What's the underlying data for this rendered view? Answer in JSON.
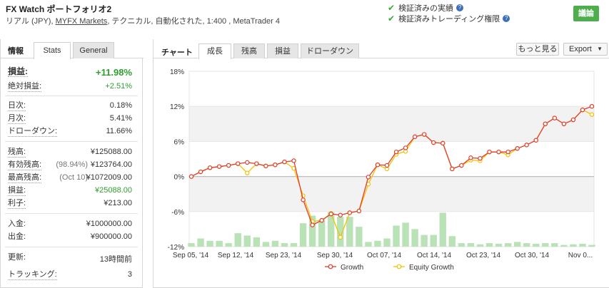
{
  "header": {
    "title": "FX Watch ポートフォリオ2",
    "sub_type": "リアル (JPY),",
    "sub_broker": "MYFX Markets",
    "sub_rest": ", テクニカル, 自動化された, 1:400 , MetaTrader 4",
    "verify_1": "検証済みの実績",
    "verify_2": "検証済みトレーディング権限",
    "discuss_label": "議論"
  },
  "left_tabs": {
    "info": "情報",
    "stats": "Stats",
    "general": "General"
  },
  "stats": {
    "profit_label": "損益:",
    "profit_value": "+11.98%",
    "abs_label": "絶対損益:",
    "abs_value": "+2.51%",
    "daily_label": "日次:",
    "daily_value": "0.18%",
    "monthly_label": "月次:",
    "monthly_value": "5.41%",
    "dd_label": "ドローダウン:",
    "dd_value": "11.66%",
    "balance_label": "残高:",
    "balance_value": "¥125088.00",
    "equity_label": "有効残高:",
    "equity_note": "(98.94%)",
    "equity_value": "¥123764.00",
    "high_label": "最高残高:",
    "high_note": "(Oct 10)",
    "high_value": "¥1072009.00",
    "pl_label": "損益:",
    "pl_value": "¥25088.00",
    "interest_label": "利子:",
    "interest_value": "¥213.00",
    "deposit_label": "入金:",
    "deposit_value": "¥1000000.00",
    "withdraw_label": "出金:",
    "withdraw_value": "¥900000.00",
    "updated_label": "更新:",
    "updated_value": "13時間前",
    "tracking_label": "トラッキング:",
    "tracking_value": "3"
  },
  "right_tabs": {
    "chart_label": "チャート",
    "growth": "成長",
    "balance": "残高",
    "profit": "損益",
    "drawdown": "ドローダウン",
    "more": "もっと見る",
    "export": "Export"
  },
  "chart_data": {
    "type": "line",
    "y_ticks": [
      "18%",
      "12%",
      "6%",
      "0%",
      "-6%",
      "-12%"
    ],
    "ylim": [
      -12,
      18
    ],
    "x_tick_labels": [
      "Sep 05, '14",
      "Sep 12, '14",
      "Sep 23, '14",
      "Sep 30, '14",
      "Oct 07, '14",
      "Oct 14, '14",
      "Oct 23, '14",
      "Oct 30, '14",
      "Nov 0..."
    ],
    "series": [
      {
        "name": "Growth",
        "color": "#e03c2e",
        "values": [
          0,
          0.8,
          1.5,
          1.7,
          1.9,
          2.2,
          2.4,
          2.2,
          1.8,
          2.0,
          2.5,
          2.7,
          -4.0,
          -8.3,
          -7.5,
          -6.4,
          -6.6,
          -6.2,
          -5.9,
          -0.1,
          2.0,
          1.9,
          4.2,
          4.9,
          6.8,
          7.2,
          5.8,
          5.7,
          1.3,
          1.9,
          3.2,
          3.1,
          4.2,
          4.2,
          4.2,
          4.8,
          5.4,
          6.2,
          9.0,
          10.0,
          9.0,
          9.7,
          11.4,
          12.0
        ]
      },
      {
        "name": "Equity Growth",
        "color": "#f2c200",
        "values": [
          0,
          0.8,
          1.5,
          1.7,
          1.9,
          2.2,
          0.6,
          2.2,
          1.8,
          2.0,
          2.5,
          1.4,
          -3.3,
          -7.7,
          -7.5,
          -6.3,
          -10.4,
          -6.2,
          -5.9,
          -1.3,
          2.0,
          1.3,
          3.8,
          4.3,
          6.8,
          7.2,
          5.8,
          5.7,
          1.3,
          1.9,
          2.8,
          2.7,
          4.2,
          4.2,
          3.7,
          4.8,
          5.4,
          6.2,
          9.0,
          10.0,
          9.0,
          9.7,
          11.4,
          10.6
        ]
      }
    ],
    "bars": [
      0.6,
      1.4,
      1.0,
      1.0,
      0.6,
      2.3,
      1.9,
      1.6,
      0.8,
      1.0,
      0.6,
      0.6,
      4.0,
      5.3,
      4.6,
      5.9,
      5.1,
      5.1,
      3.4,
      0.8,
      1.0,
      1.4,
      3.6,
      4.1,
      3.0,
      2.0,
      2.0,
      5.8,
      1.8,
      0.6,
      0.6,
      0.4,
      0.6,
      0.5,
      0.6,
      0.8,
      0.6,
      0.5,
      0.6,
      0.6,
      0.3,
      0.4,
      0.5,
      0.3
    ],
    "legend": {
      "position": "bottom"
    }
  }
}
